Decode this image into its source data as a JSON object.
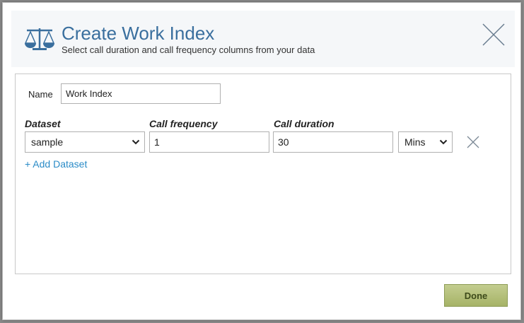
{
  "dialog": {
    "title": "Create Work Index",
    "subtitle": "Select call duration and call frequency columns from your data",
    "icon": "scale-icon",
    "close_icon": "close-icon"
  },
  "form": {
    "name_label": "Name",
    "name_value": "Work Index",
    "columns": {
      "dataset": "Dataset",
      "call_frequency": "Call frequency",
      "call_duration": "Call duration"
    },
    "row": {
      "dataset": "sample",
      "call_frequency": "1",
      "call_duration": "30",
      "unit": "Mins"
    },
    "add_dataset_label": "+ Add Dataset"
  },
  "footer": {
    "done_label": "Done"
  },
  "colors": {
    "title": "#3a6f9e",
    "link": "#2a8bc7",
    "done_button": "#b3bf77"
  }
}
